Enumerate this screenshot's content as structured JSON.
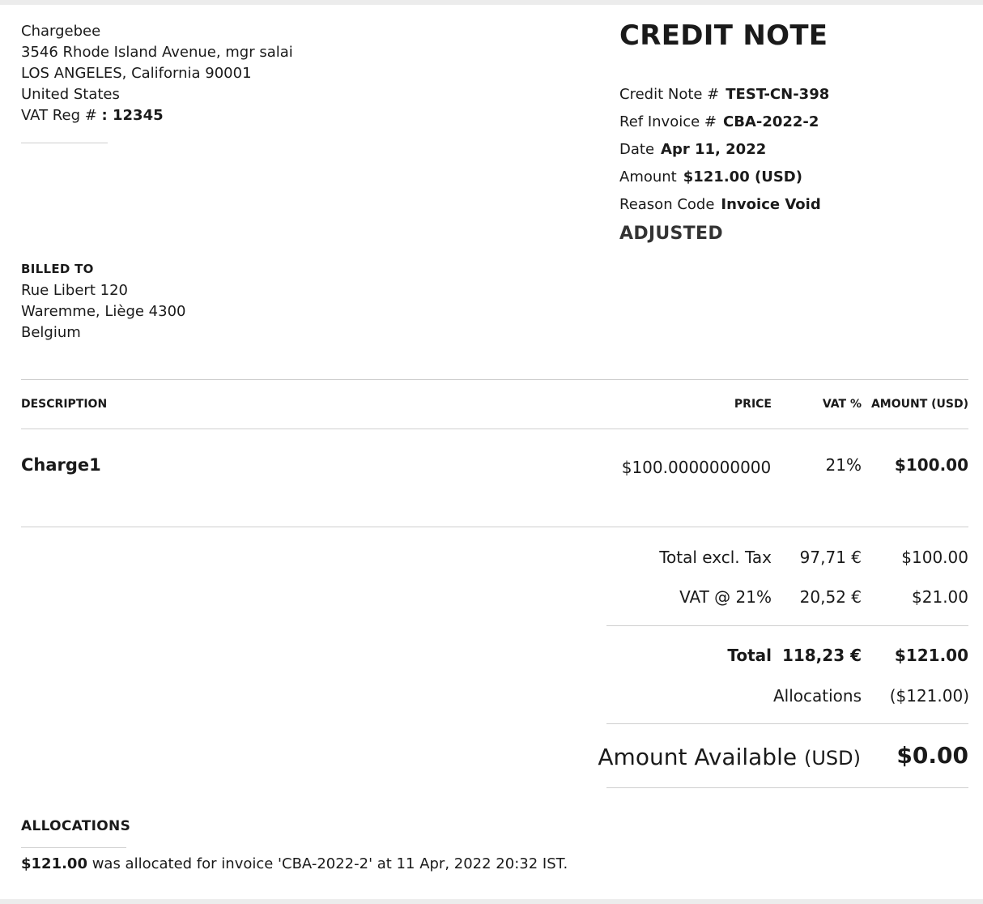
{
  "seller": {
    "name": "Chargebee",
    "address_line1": "3546 Rhode Island Avenue, mgr salai",
    "address_line2": "LOS ANGELES, California 90001",
    "country": "United States",
    "vat_label": "VAT Reg # ",
    "vat_value": ": 12345"
  },
  "document": {
    "title": "CREDIT NOTE",
    "meta": [
      {
        "label": "Credit Note #",
        "value": "TEST-CN-398"
      },
      {
        "label": "Ref Invoice #",
        "value": "CBA-2022-2"
      },
      {
        "label": "Date",
        "value": "Apr 11, 2022"
      },
      {
        "label": "Amount",
        "value": "$121.00 (USD)"
      },
      {
        "label": "Reason Code",
        "value": "Invoice Void"
      }
    ],
    "status": "ADJUSTED"
  },
  "billed_to": {
    "heading": "BILLED TO",
    "line1": "Rue Libert 120",
    "line2": "Waremme, Liège 4300",
    "country": "Belgium"
  },
  "table": {
    "headers": {
      "description": "DESCRIPTION",
      "price": "PRICE",
      "vat": "VAT %",
      "amount": "AMOUNT (USD)"
    },
    "items": [
      {
        "description": "Charge1",
        "price": "$100.0000000000",
        "vat": "21%",
        "amount": "$100.00"
      }
    ]
  },
  "totals": {
    "excl_tax": {
      "label": "Total excl. Tax",
      "eur": "97,71 €",
      "usd": "$100.00"
    },
    "vat": {
      "label": "VAT @ 21%",
      "eur": "20,52 €",
      "usd": "$21.00"
    },
    "total": {
      "label": "Total",
      "eur": "118,23 €",
      "usd": "$121.00"
    },
    "allocations": {
      "label": "Allocations",
      "usd": "($121.00)"
    },
    "amount_available": {
      "label": "Amount Available",
      "unit": "(USD)",
      "value": "$0.00"
    }
  },
  "allocations_section": {
    "heading": "ALLOCATIONS",
    "amount": "$121.00",
    "text": " was allocated for invoice 'CBA-2022-2' at 11 Apr, 2022 20:32 IST."
  }
}
